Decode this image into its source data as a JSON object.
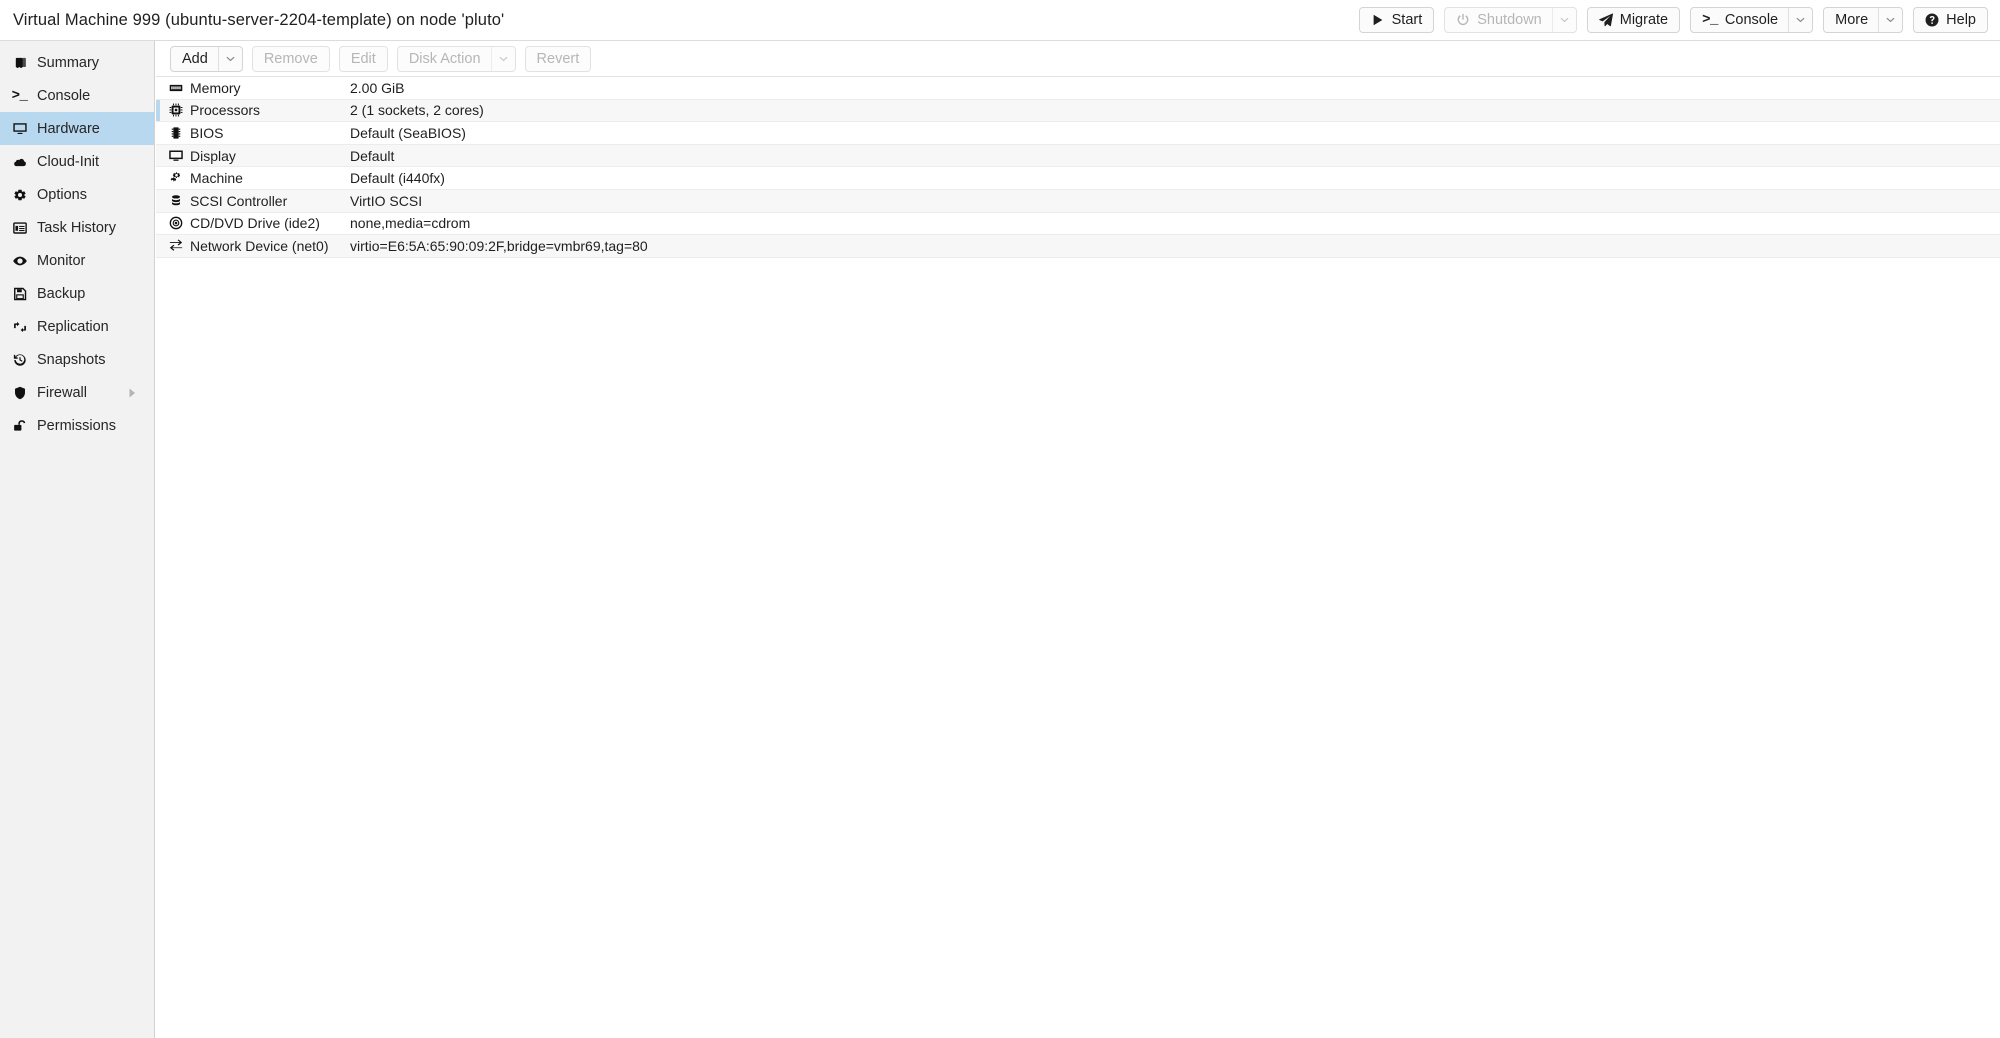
{
  "header": {
    "title": "Virtual Machine 999 (ubuntu-server-2204-template) on node 'pluto'",
    "actions": [
      {
        "label": "Start",
        "icon": "play-icon",
        "disabled": false,
        "split": false
      },
      {
        "label": "Shutdown",
        "icon": "power-icon",
        "disabled": true,
        "split": true
      },
      {
        "label": "Migrate",
        "icon": "paperplane-icon",
        "disabled": false,
        "split": false
      },
      {
        "label": "Console",
        "icon": "terminal-icon",
        "disabled": false,
        "split": true
      },
      {
        "label": "More",
        "icon": "none",
        "disabled": false,
        "split": true
      },
      {
        "label": "Help",
        "icon": "question-circle-icon",
        "disabled": false,
        "split": false
      }
    ]
  },
  "sidebar": {
    "items": [
      {
        "label": "Summary",
        "icon": "book-icon",
        "selected": false,
        "submenu": false
      },
      {
        "label": "Console",
        "icon": "terminal-icon",
        "selected": false,
        "submenu": false
      },
      {
        "label": "Hardware",
        "icon": "monitor-icon",
        "selected": true,
        "submenu": false
      },
      {
        "label": "Cloud-Init",
        "icon": "cloud-icon",
        "selected": false,
        "submenu": false
      },
      {
        "label": "Options",
        "icon": "gear-icon",
        "selected": false,
        "submenu": false
      },
      {
        "label": "Task History",
        "icon": "list-window-icon",
        "selected": false,
        "submenu": false
      },
      {
        "label": "Monitor",
        "icon": "eye-icon",
        "selected": false,
        "submenu": false
      },
      {
        "label": "Backup",
        "icon": "floppy-icon",
        "selected": false,
        "submenu": false
      },
      {
        "label": "Replication",
        "icon": "retweet-icon",
        "selected": false,
        "submenu": false
      },
      {
        "label": "Snapshots",
        "icon": "history-icon",
        "selected": false,
        "submenu": false
      },
      {
        "label": "Firewall",
        "icon": "shield-icon",
        "selected": false,
        "submenu": true
      },
      {
        "label": "Permissions",
        "icon": "unlock-icon",
        "selected": false,
        "submenu": false
      }
    ]
  },
  "toolbar": {
    "buttons": [
      {
        "label": "Add",
        "disabled": false,
        "split": true
      },
      {
        "label": "Remove",
        "disabled": true,
        "split": false
      },
      {
        "label": "Edit",
        "disabled": true,
        "split": false
      },
      {
        "label": "Disk Action",
        "disabled": true,
        "split": true
      },
      {
        "label": "Revert",
        "disabled": true,
        "split": false
      }
    ]
  },
  "hardware": {
    "rows": [
      {
        "icon": "memory-icon",
        "key": "Memory",
        "value": "2.00 GiB"
      },
      {
        "icon": "cpu-icon",
        "key": "Processors",
        "value": "2 (1 sockets, 2 cores)"
      },
      {
        "icon": "bios-chip-icon",
        "key": "BIOS",
        "value": "Default (SeaBIOS)"
      },
      {
        "icon": "display-icon",
        "key": "Display",
        "value": "Default"
      },
      {
        "icon": "cogs-icon",
        "key": "Machine",
        "value": "Default (i440fx)"
      },
      {
        "icon": "database-icon",
        "key": "SCSI Controller",
        "value": "VirtIO SCSI"
      },
      {
        "icon": "disc-icon",
        "key": "CD/DVD Drive (ide2)",
        "value": "none,media=cdrom"
      },
      {
        "icon": "exchange-icon",
        "key": "Network Device (net0)",
        "value": "virtio=E6:5A:65:90:09:2F,bridge=vmbr69,tag=80"
      }
    ]
  },
  "colors": {
    "selection": "#b7d8ef",
    "sidebar_bg": "#f2f2f2",
    "row_alt_bg": "#f7f7f7",
    "border": "#d2d2d2",
    "text": "#1f1f1f",
    "text_disabled": "#b6b6b6"
  }
}
